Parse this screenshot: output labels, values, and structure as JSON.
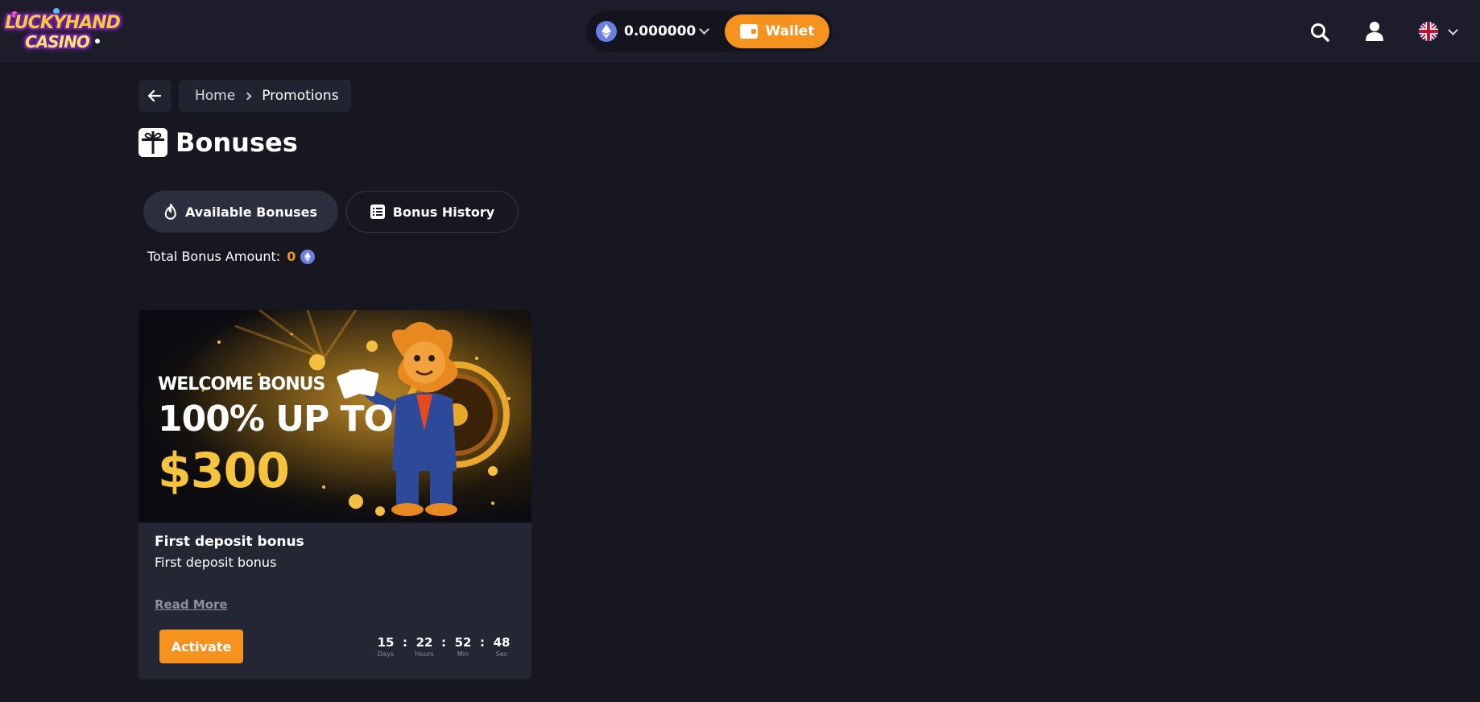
{
  "header": {
    "logo": {
      "line1": "LUCKYHAND",
      "line2": "CASINO"
    },
    "balance": {
      "currency_icon": "ethereum-icon",
      "value": "0.000000"
    },
    "wallet_label": "Wallet",
    "icons": [
      "search-icon",
      "user-icon",
      "uk-flag-icon",
      "chevron-down-icon"
    ]
  },
  "breadcrumb": {
    "home": "Home",
    "current": "Promotions"
  },
  "page": {
    "title": "Bonuses",
    "title_icon": "gift-icon"
  },
  "tabs": [
    {
      "label": "Available Bonuses",
      "icon": "flame-icon",
      "active": true
    },
    {
      "label": "Bonus History",
      "icon": "list-icon",
      "active": false
    }
  ],
  "total": {
    "label": "Total Bonus Amount:",
    "value": "0",
    "currency_icon": "ethereum-icon"
  },
  "bonus_card": {
    "banner": {
      "line1": "WELCOME BONUS",
      "line2": "100% UP TO",
      "line3": "$300"
    },
    "title": "First deposit bonus",
    "subtitle": "First deposit bonus",
    "read_more": "Read More",
    "activate_label": "Activate",
    "countdown": [
      {
        "value": "15",
        "label": "Days"
      },
      {
        "value": "22",
        "label": "Hours"
      },
      {
        "value": "52",
        "label": "Min"
      },
      {
        "value": "48",
        "label": "Sec"
      }
    ]
  },
  "colors": {
    "accent": "#f6921e",
    "background": "#171722",
    "card": "#242634",
    "eth": "#6b7fe3"
  }
}
